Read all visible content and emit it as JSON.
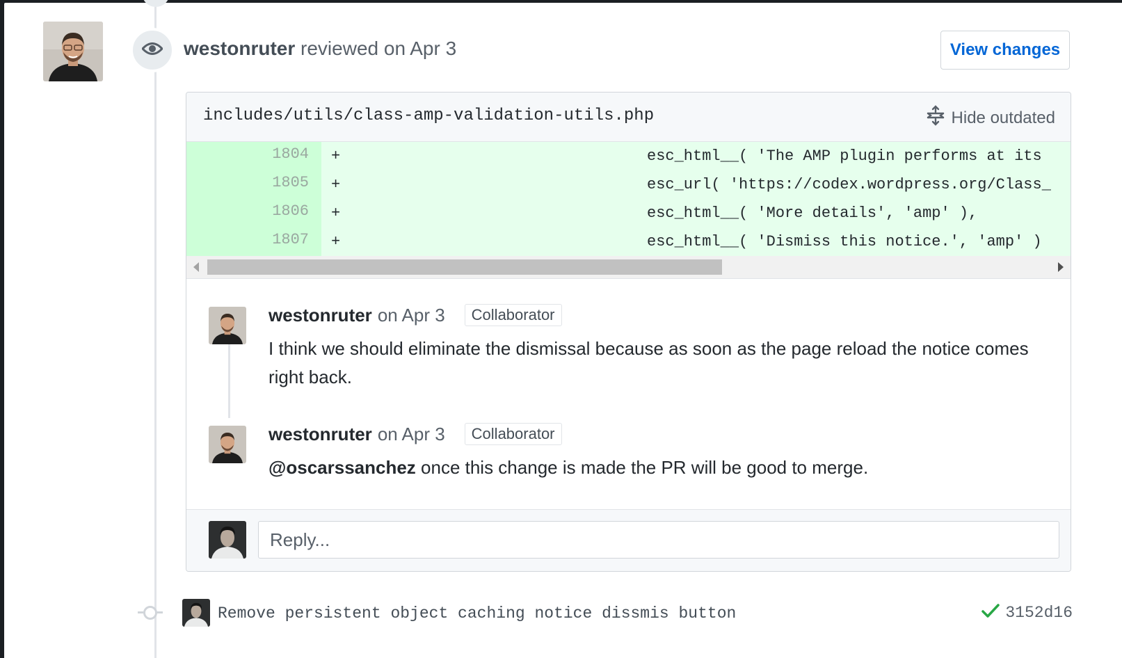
{
  "review": {
    "author": "westonruter",
    "action": "reviewed on Apr 3",
    "view_changes_label": "View changes",
    "icon": "eye-icon"
  },
  "file": {
    "path": "includes/utils/class-amp-validation-utils.php",
    "hide_outdated_label": "Hide outdated",
    "diff_lines": [
      {
        "number": "1804",
        "marker": "+",
        "code": "esc_html__( 'The AMP plugin performs at its"
      },
      {
        "number": "1805",
        "marker": "+",
        "code": "esc_url( 'https://codex.wordpress.org/Class_"
      },
      {
        "number": "1806",
        "marker": "+",
        "code": "esc_html__( 'More details', 'amp' ),"
      },
      {
        "number": "1807",
        "marker": "+",
        "code": "esc_html__( 'Dismiss this notice.', 'amp' )"
      }
    ]
  },
  "comments": [
    {
      "author": "westonruter",
      "date": "on Apr 3",
      "role": "Collaborator",
      "body": "I think we should eliminate the dismissal because as soon as the page reload the notice comes right back."
    },
    {
      "author": "westonruter",
      "date": "on Apr 3",
      "role": "Collaborator",
      "mention": "@oscarssanchez",
      "body": " once this change is made the PR will be good to merge."
    }
  ],
  "reply": {
    "placeholder": "Reply..."
  },
  "commit": {
    "message": "Remove persistent object caching notice dissmis button",
    "sha": "3152d16",
    "status": "success",
    "status_color": "#28a745"
  },
  "colors": {
    "link": "#0366d6",
    "diff_add_bg": "#e6ffed",
    "diff_add_num_bg": "#cdffd8"
  }
}
